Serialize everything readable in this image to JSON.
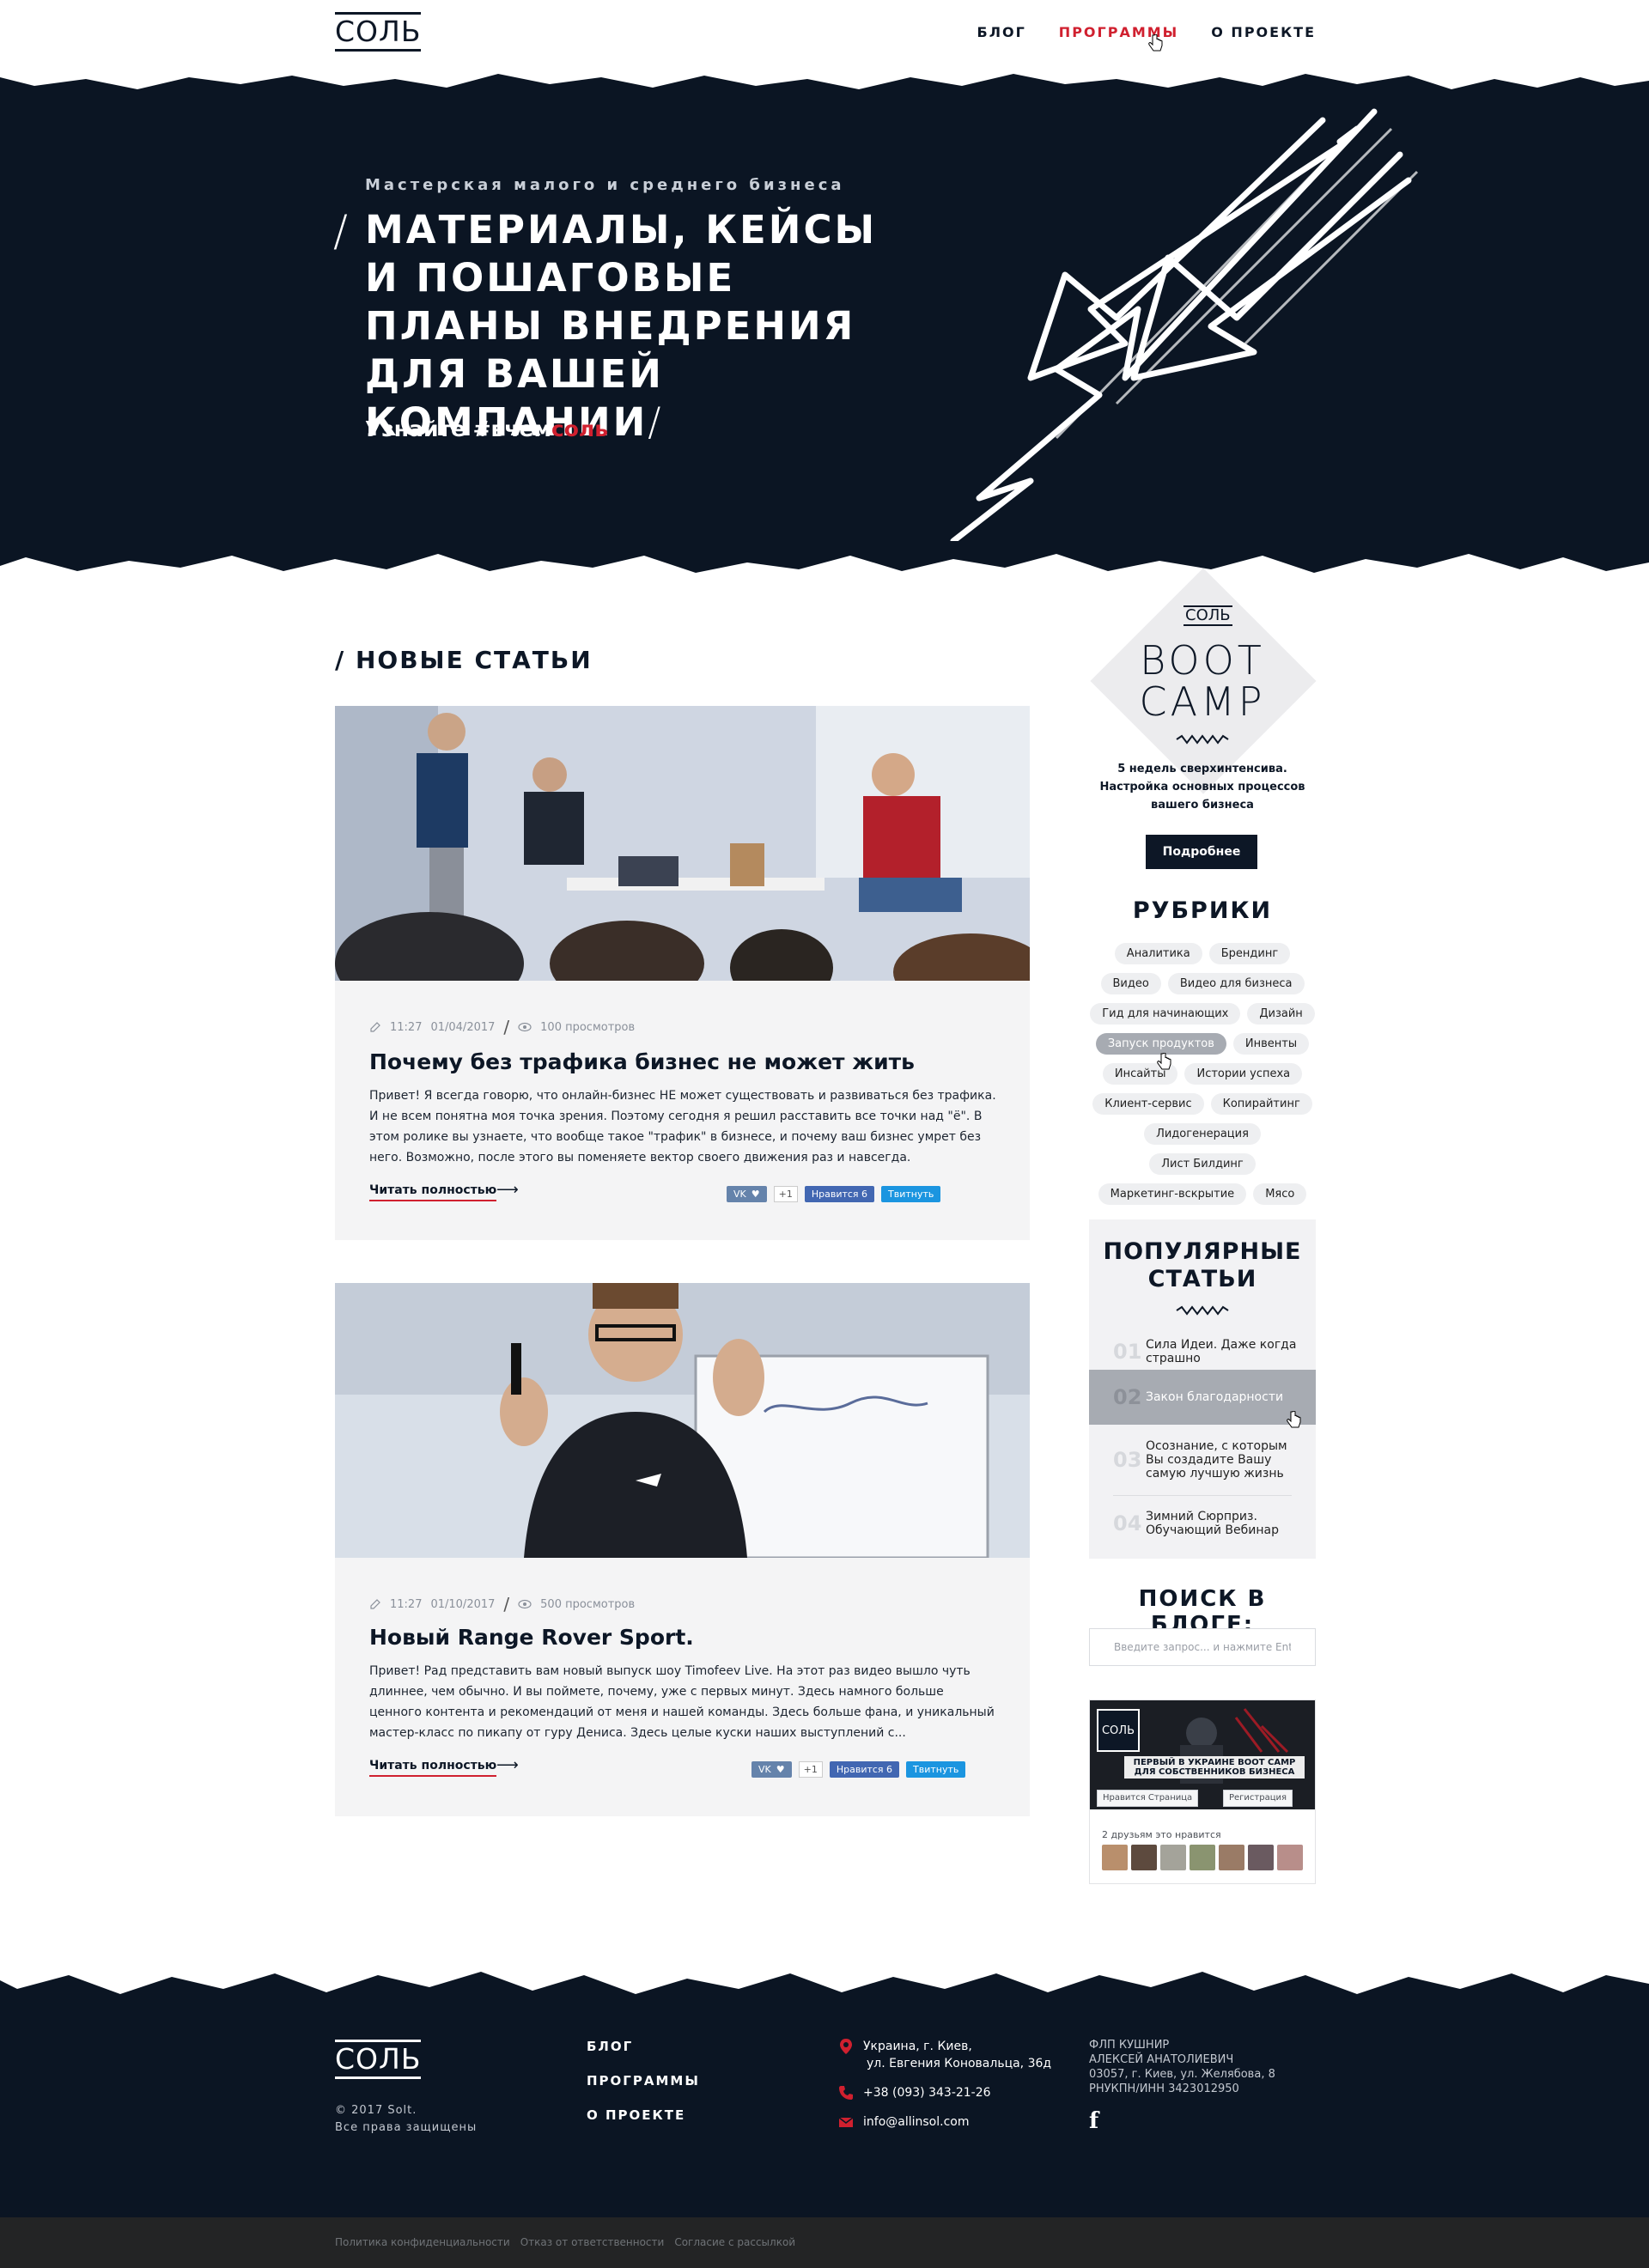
{
  "header": {
    "logo": "СОЛЬ",
    "nav": [
      "БЛОГ",
      "ПРОГРАММЫ",
      "О ПРОЕКТЕ"
    ],
    "active_nav": "ПРОГРАММЫ"
  },
  "hero": {
    "subtitle": "Мастерская малого и среднего бизнеса",
    "title_slash": "/",
    "title": "МАТЕРИАЛЫ, КЕЙСЫ И ПОШАГОВЫЕ ПЛАНЫ ВНЕДРЕНИЯ ДЛЯ ВАШЕЙ КОМПАНИИ",
    "title_slash_end": "/",
    "cta_prefix": "Узнайте #вчем",
    "cta_accent": "соль"
  },
  "main": {
    "section_title": "/ НОВЫЕ СТАТЬИ",
    "articles": [
      {
        "time": "11:27",
        "date": "01/04/2017",
        "views": "100 просмотров",
        "title": "Почему без трафика бизнес не может жить",
        "text": "Привет! Я всегда говорю, что онлайн-бизнес НЕ может существовать и развиваться без трафика. И не всем понятна моя точка зрения. Поэтому сегодня я решил расставить все точки над \"ё\". В этом ролике вы узнаете, что вообще такое \"трафик\" в бизнесе, и почему ваш бизнес умрет без него. Возможно, после этого вы поменяете вектор своего движения раз и навсегда.",
        "read_more": "Читать полностью",
        "vk_count": "+1",
        "fb_label": "Нравится 6",
        "tw_label": "Твитнуть"
      },
      {
        "time": "11:27",
        "date": "01/10/2017",
        "views": "500 просмотров",
        "title": "Новый Range Rover Sport.",
        "text": "Привет! Рад представить вам новый выпуск шоу Timofeev Live. На этот раз видео вышло чуть длиннее, чем обычно. И вы поймете, почему, уже с первых минут. Здесь намного больше ценного контента и рекомендаций от меня и нашей команды. Здесь больше фана, и уникальный мастер-класс по пикапу от гуру Дениса. Здесь целые куски наших выступлений с...",
        "read_more": "Читать полностью",
        "vk_count": "+1",
        "fb_label": "Нравится 6",
        "tw_label": "Твитнуть"
      }
    ]
  },
  "sidebar": {
    "bootcamp": {
      "logo": "СОЛЬ",
      "title_line1": "BOOT",
      "title_line2": "CAMP",
      "description": "5 недель сверхинтенсива. Настройка основных процессов вашего бизнеса",
      "button": "Подробнее"
    },
    "rubrics_title": "РУБРИКИ",
    "tags": [
      "Аналитика",
      "Брендинг",
      "Видео",
      "Видео для бизнеса",
      "Гид для начинающих",
      "Дизайн",
      "Запуск продуктов",
      "Инвенты",
      "Инсайты",
      "Истории успеха",
      "Клиент-сервис",
      "Копирайтинг",
      "Лидогенерация",
      "Лист Билдинг",
      "Маркетинг-вскрытие",
      "Мясо"
    ],
    "active_tag": "Запуск продуктов",
    "popular_title": "ПОПУЛЯРНЫЕ СТАТЬИ",
    "popular": [
      {
        "num": "01",
        "title": "Сила Идеи. Даже когда страшно"
      },
      {
        "num": "02",
        "title": "Закон благодарности"
      },
      {
        "num": "03",
        "title": "Осознание, с которым Вы создадите Вашу самую лучшую жизнь"
      },
      {
        "num": "04",
        "title": "Зимний Сюрприз. Обучающий Вебинар"
      }
    ],
    "search_title": "ПОИСК В БЛОГЕ:",
    "search_placeholder": "Введите запрос... и нажмите Enter",
    "fb": {
      "logo": "СОЛЬ",
      "banner_line1": "ПЕРВЫЙ В УКРАИНЕ BOOT CAMP",
      "banner_line2": "ДЛЯ СОБСТВЕННИКОВ БИЗНЕСА",
      "like_btn": "Нравится Страница",
      "register_btn": "Регистрация",
      "friends_like": "2 друзьям это нравится"
    }
  },
  "footer": {
    "logo": "СОЛЬ",
    "copyright_line1": "© 2017 Solt.",
    "copyright_line2": "Все права защищены",
    "nav": [
      "БЛОГ",
      "ПРОГРАММЫ",
      "О ПРОЕКТЕ"
    ],
    "address_line1": "Украина, г. Киев,",
    "address_line2": "ул. Евгения Коновальца, 36д",
    "phone": "+38 (093) 343-21-26",
    "email": "info@allinsol.com",
    "legal_line1": "ФЛП КУШНИР",
    "legal_line2": "АЛЕКСЕЙ АНАТОЛИЕВИЧ",
    "legal_line3": "03057, г. Киев, ул. Желябова, 8",
    "legal_line4": "РНУКПН/ИНН  3423012950",
    "fb_icon": "f"
  },
  "bottom_links": [
    "Политика конфиденциальности",
    "Отказ от ответственности",
    "Согласие с рассылкой"
  ],
  "colors": {
    "navy": "#0b1523",
    "accent": "#d0202f",
    "gray_bg": "#f4f4f5"
  }
}
